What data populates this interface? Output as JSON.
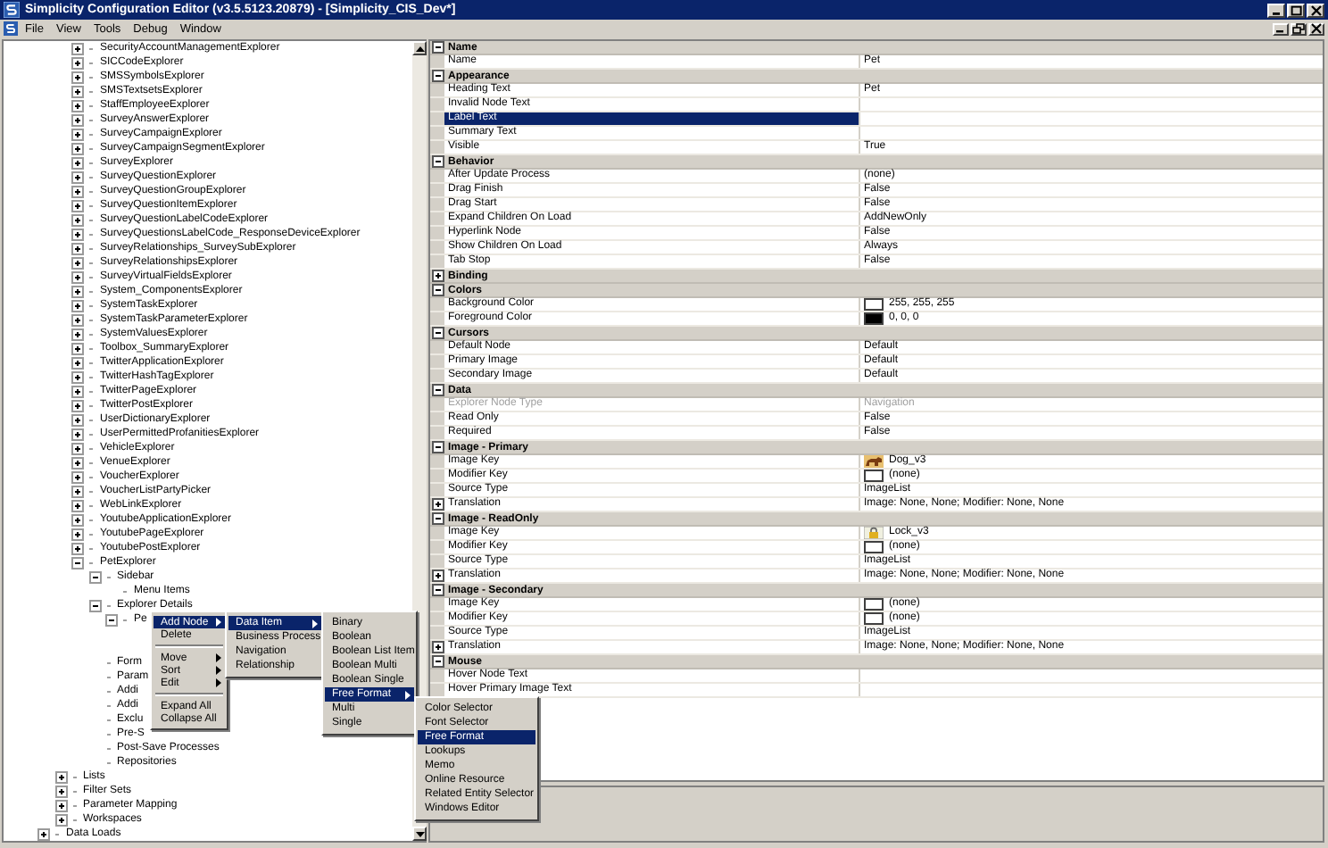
{
  "window": {
    "title": "Simplicity Configuration Editor (v3.5.5123.20879) - [Simplicity_CIS_Dev*]"
  },
  "menu": [
    "File",
    "View",
    "Tools",
    "Debug",
    "Window"
  ],
  "tree": {
    "items": [
      {
        "kind": "continued",
        "children": [
          {
            "kind": "continued",
            "children": [
              {
                "label": "SecurityAccountManagementExplorer",
                "kind": "node",
                "expanded": false
              },
              {
                "label": "SICCodeExplorer",
                "kind": "node",
                "expanded": false
              },
              {
                "label": "SMSSymbolsExplorer",
                "kind": "node",
                "expanded": false
              },
              {
                "label": "SMSTextsetsExplorer",
                "kind": "node",
                "expanded": false
              },
              {
                "label": "StaffEmployeeExplorer",
                "kind": "node",
                "expanded": false
              },
              {
                "label": "SurveyAnswerExplorer",
                "kind": "node",
                "expanded": false
              },
              {
                "label": "SurveyCampaignExplorer",
                "kind": "node",
                "expanded": false
              },
              {
                "label": "SurveyCampaignSegmentExplorer",
                "kind": "node",
                "expanded": false
              },
              {
                "label": "SurveyExplorer",
                "kind": "node",
                "expanded": false
              },
              {
                "label": "SurveyQuestionExplorer",
                "kind": "node",
                "expanded": false
              },
              {
                "label": "SurveyQuestionGroupExplorer",
                "kind": "node",
                "expanded": false
              },
              {
                "label": "SurveyQuestionItemExplorer",
                "kind": "node",
                "expanded": false
              },
              {
                "label": "SurveyQuestionLabelCodeExplorer",
                "kind": "node",
                "expanded": false
              },
              {
                "label": "SurveyQuestionsLabelCode_ResponseDeviceExplorer",
                "kind": "node",
                "expanded": false
              },
              {
                "label": "SurveyRelationships_SurveySubExplorer",
                "kind": "node",
                "expanded": false
              },
              {
                "label": "SurveyRelationshipsExplorer",
                "kind": "node",
                "expanded": false
              },
              {
                "label": "SurveyVirtualFieldsExplorer",
                "kind": "node",
                "expanded": false
              },
              {
                "label": "System_ComponentsExplorer",
                "kind": "node",
                "expanded": false
              },
              {
                "label": "SystemTaskExplorer",
                "kind": "node",
                "expanded": false
              },
              {
                "label": "SystemTaskParameterExplorer",
                "kind": "node",
                "expanded": false
              },
              {
                "label": "SystemValuesExplorer",
                "kind": "node",
                "expanded": false
              },
              {
                "label": "Toolbox_SummaryExplorer",
                "kind": "node",
                "expanded": false
              },
              {
                "label": "TwitterApplicationExplorer",
                "kind": "node",
                "expanded": false
              },
              {
                "label": "TwitterHashTagExplorer",
                "kind": "node",
                "expanded": false
              },
              {
                "label": "TwitterPageExplorer",
                "kind": "node",
                "expanded": false
              },
              {
                "label": "TwitterPostExplorer",
                "kind": "node",
                "expanded": false
              },
              {
                "label": "UserDictionaryExplorer",
                "kind": "node",
                "expanded": false
              },
              {
                "label": "UserPermittedProfanitiesExplorer",
                "kind": "node",
                "expanded": false
              },
              {
                "label": "VehicleExplorer",
                "kind": "node",
                "expanded": false
              },
              {
                "label": "VenueExplorer",
                "kind": "node",
                "expanded": false
              },
              {
                "label": "VoucherExplorer",
                "kind": "node",
                "expanded": false
              },
              {
                "label": "VoucherListPartyPicker",
                "kind": "node",
                "expanded": false
              },
              {
                "label": "WebLinkExplorer",
                "kind": "node",
                "expanded": false
              },
              {
                "label": "YoutubeApplicationExplorer",
                "kind": "node",
                "expanded": false
              },
              {
                "label": "YoutubePageExplorer",
                "kind": "node",
                "expanded": false
              },
              {
                "label": "YoutubePostExplorer",
                "kind": "node",
                "expanded": false
              },
              {
                "label": "PetExplorer",
                "kind": "node",
                "expanded": true,
                "children": [
                  {
                    "label": "Sidebar",
                    "kind": "node",
                    "expanded": true,
                    "children": [
                      {
                        "label": "Menu Items",
                        "kind": "leaf"
                      }
                    ]
                  },
                  {
                    "label": "Explorer Details",
                    "kind": "node",
                    "expanded": true,
                    "children": [
                      {
                        "label": "Pe",
                        "kind": "node",
                        "expanded": true
                      }
                    ]
                  },
                  {
                    "label": "Form",
                    "kind": "leaf"
                  },
                  {
                    "label": "Param",
                    "kind": "leaf"
                  },
                  {
                    "label": "Addi",
                    "kind": "leaf"
                  },
                  {
                    "label": "Addi",
                    "kind": "leaf"
                  },
                  {
                    "label": "Exclu",
                    "kind": "leaf"
                  },
                  {
                    "label": "Pre-S",
                    "kind": "leaf"
                  },
                  {
                    "label": "Post-Save Processes",
                    "kind": "leaf"
                  },
                  {
                    "label": "Repositories",
                    "kind": "leaf"
                  }
                ]
              }
            ]
          },
          {
            "label": "Lists",
            "kind": "node",
            "expanded": false
          },
          {
            "label": "Filter Sets",
            "kind": "node",
            "expanded": false
          },
          {
            "label": "Parameter Mapping",
            "kind": "node",
            "expanded": false
          },
          {
            "label": "Workspaces",
            "kind": "node",
            "expanded": false
          }
        ]
      },
      {
        "label": "Data Loads",
        "kind": "node",
        "expanded": false
      }
    ]
  },
  "properties": {
    "categories": [
      {
        "name": "Name",
        "expanded": true,
        "rows": [
          {
            "name": "Name",
            "value": "Pet",
            "kind": "text",
            "selected": false
          }
        ]
      },
      {
        "name": "Appearance",
        "expanded": true,
        "rows": [
          {
            "name": "Heading Text",
            "value": "Pet",
            "kind": "text",
            "selected": false
          },
          {
            "name": "Invalid Node Text",
            "kind": "text",
            "selected": false
          },
          {
            "name": "Label Text",
            "kind": "text",
            "selected": true
          },
          {
            "name": "Summary Text",
            "kind": "text",
            "selected": false
          },
          {
            "name": "Visible",
            "value": "True",
            "kind": "text",
            "selected": false
          }
        ]
      },
      {
        "name": "Behavior",
        "expanded": true,
        "rows": [
          {
            "name": "After Update Process",
            "value": "(none)",
            "kind": "text",
            "selected": false
          },
          {
            "name": "Drag Finish",
            "value": "False",
            "kind": "text",
            "selected": false
          },
          {
            "name": "Drag Start",
            "value": "False",
            "kind": "text",
            "selected": false
          },
          {
            "name": "Expand Children On Load",
            "value": "AddNewOnly",
            "kind": "text",
            "selected": false
          },
          {
            "name": "Hyperlink Node",
            "value": "False",
            "kind": "text",
            "selected": false
          },
          {
            "name": "Show Children On Load",
            "value": "Always",
            "kind": "text",
            "selected": false
          },
          {
            "name": "Tab Stop",
            "value": "False",
            "kind": "text",
            "selected": false
          }
        ]
      },
      {
        "name": "Binding",
        "expanded": false
      },
      {
        "name": "Colors",
        "expanded": true,
        "rows": [
          {
            "name": "Background Color",
            "value": "255, 255, 255",
            "kind": "color",
            "color": "#ffffff",
            "selected": false
          },
          {
            "name": "Foreground Color",
            "value": "0, 0, 0",
            "kind": "color",
            "color": "#000000",
            "selected": false
          }
        ]
      },
      {
        "name": "Cursors",
        "expanded": true,
        "rows": [
          {
            "name": "Default Node",
            "value": "Default",
            "kind": "text",
            "selected": false
          },
          {
            "name": "Primary Image",
            "value": "Default",
            "kind": "text",
            "selected": false
          },
          {
            "name": "Secondary Image",
            "value": "Default",
            "kind": "text",
            "selected": false
          }
        ]
      },
      {
        "name": "Data",
        "expanded": true,
        "rows": [
          {
            "name": "Explorer Node Type",
            "value": "Navigation",
            "kind": "disabled",
            "selected": false
          },
          {
            "name": "Read Only",
            "value": "False",
            "kind": "text",
            "selected": false
          },
          {
            "name": "Required",
            "value": "False",
            "kind": "text",
            "selected": false
          }
        ]
      },
      {
        "name": "Image - Primary",
        "expanded": true,
        "rows": [
          {
            "name": "Image Key",
            "value": "Dog_v3",
            "kind": "dog-image",
            "selected": false
          },
          {
            "name": "Modifier Key",
            "value": "(none)",
            "kind": "empty-swatch",
            "selected": false
          },
          {
            "name": "Source Type",
            "value": "ImageList",
            "kind": "text",
            "selected": false
          },
          {
            "name": "Translation",
            "value": "Image: None, None; Modifier: None, None",
            "kind": "group",
            "expanded": false,
            "selected": false
          }
        ]
      },
      {
        "name": "Image - ReadOnly",
        "expanded": true,
        "rows": [
          {
            "name": "Image Key",
            "value": "Lock_v3",
            "kind": "lock-image",
            "selected": false
          },
          {
            "name": "Modifier Key",
            "value": "(none)",
            "kind": "empty-swatch",
            "selected": false
          },
          {
            "name": "Source Type",
            "value": "ImageList",
            "kind": "text",
            "selected": false
          },
          {
            "name": "Translation",
            "value": "Image: None, None; Modifier: None, None",
            "kind": "group",
            "expanded": false,
            "selected": false
          }
        ]
      },
      {
        "name": "Image - Secondary",
        "expanded": true,
        "rows": [
          {
            "name": "Image Key",
            "value": "(none)",
            "kind": "empty-swatch",
            "selected": false
          },
          {
            "name": "Modifier Key",
            "value": "(none)",
            "kind": "empty-swatch",
            "selected": false
          },
          {
            "name": "Source Type",
            "value": "ImageList",
            "kind": "text",
            "selected": false
          },
          {
            "name": "Translation",
            "value": "Image: None, None; Modifier: None, None",
            "kind": "group",
            "expanded": false,
            "selected": false
          }
        ]
      },
      {
        "name": "Mouse",
        "expanded": true,
        "rows": [
          {
            "name": "Hover Node Text",
            "kind": "text",
            "selected": false
          },
          {
            "name": "Hover Primary Image Text",
            "kind": "text",
            "selected": false
          }
        ]
      }
    ]
  },
  "context_menus": [
    {
      "items": [
        {
          "kind": "item",
          "label": "Add Node",
          "submenu": true,
          "selected": true
        },
        {
          "kind": "item",
          "label": "Delete",
          "submenu": false,
          "selected": false
        },
        {
          "kind": "separator"
        },
        {
          "kind": "item",
          "label": "Move",
          "submenu": true,
          "selected": false
        },
        {
          "kind": "item",
          "label": "Sort",
          "submenu": true,
          "selected": false
        },
        {
          "kind": "item",
          "label": "Edit",
          "submenu": true,
          "selected": false
        },
        {
          "kind": "separator"
        },
        {
          "kind": "item",
          "label": "Expand All",
          "submenu": false,
          "selected": false
        },
        {
          "kind": "item",
          "label": "Collapse All",
          "submenu": false,
          "selected": false
        }
      ]
    },
    {
      "items": [
        {
          "kind": "item",
          "label": "Data Item",
          "submenu": true,
          "selected": true
        },
        {
          "kind": "item",
          "label": "Business Process",
          "submenu": false,
          "selected": false
        },
        {
          "kind": "item",
          "label": "Navigation",
          "submenu": false,
          "selected": false
        },
        {
          "kind": "item",
          "label": "Relationship",
          "submenu": false,
          "selected": false
        }
      ]
    },
    {
      "items": [
        {
          "kind": "item",
          "label": "Binary",
          "submenu": false,
          "selected": false
        },
        {
          "kind": "item",
          "label": "Boolean",
          "submenu": false,
          "selected": false
        },
        {
          "kind": "item",
          "label": "Boolean List Item",
          "submenu": false,
          "selected": false
        },
        {
          "kind": "item",
          "label": "Boolean Multi",
          "submenu": false,
          "selected": false
        },
        {
          "kind": "item",
          "label": "Boolean Single",
          "submenu": false,
          "selected": false
        },
        {
          "kind": "item",
          "label": "Free Format",
          "submenu": true,
          "selected": true
        },
        {
          "kind": "item",
          "label": "Multi",
          "submenu": false,
          "selected": false
        },
        {
          "kind": "item",
          "label": "Single",
          "submenu": false,
          "selected": false
        }
      ]
    },
    {
      "items": [
        {
          "kind": "item",
          "label": "Color Selector",
          "submenu": false,
          "selected": false
        },
        {
          "kind": "item",
          "label": "Font Selector",
          "submenu": false,
          "selected": false
        },
        {
          "kind": "item",
          "label": "Free Format",
          "submenu": false,
          "selected": true
        },
        {
          "kind": "item",
          "label": "Lookups",
          "submenu": false,
          "selected": false
        },
        {
          "kind": "item",
          "label": "Memo",
          "submenu": false,
          "selected": false
        },
        {
          "kind": "item",
          "label": "Online Resource",
          "submenu": false,
          "selected": false
        },
        {
          "kind": "item",
          "label": "Related Entity Selector",
          "submenu": false,
          "selected": false
        },
        {
          "kind": "item",
          "label": "Windows Editor",
          "submenu": false,
          "selected": false
        }
      ]
    }
  ]
}
